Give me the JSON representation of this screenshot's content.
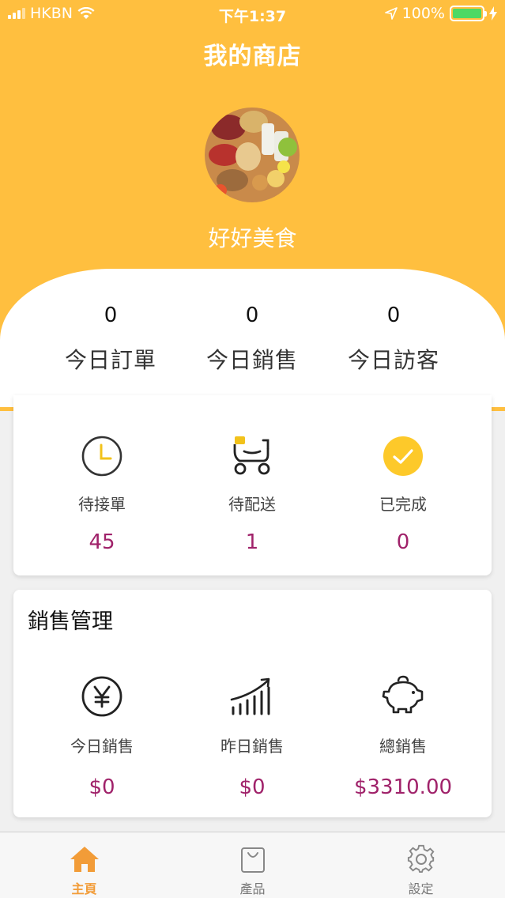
{
  "status_bar": {
    "carrier": "HKBN",
    "time": "下午1:37",
    "battery": "100%"
  },
  "header": {
    "title": "我的商店",
    "store_name": "好好美食"
  },
  "summary": [
    {
      "value": "0",
      "label": "今日訂單"
    },
    {
      "value": "0",
      "label": "今日銷售"
    },
    {
      "value": "0",
      "label": "今日訪客"
    }
  ],
  "orders": [
    {
      "icon": "clock-icon",
      "label": "待接單",
      "value": "45"
    },
    {
      "icon": "delivery-scooter-icon",
      "label": "待配送",
      "value": "1"
    },
    {
      "icon": "checkmark-circle-icon",
      "label": "已完成",
      "value": "0"
    }
  ],
  "sales": {
    "title": "銷售管理",
    "items": [
      {
        "icon": "yen-circle-icon",
        "label": "今日銷售",
        "value": "$0"
      },
      {
        "icon": "growth-chart-icon",
        "label": "昨日銷售",
        "value": "$0"
      },
      {
        "icon": "piggy-bank-icon",
        "label": "總銷售",
        "value": "$3310.00"
      }
    ]
  },
  "tabs": [
    {
      "icon": "home-icon",
      "label": "主頁",
      "active": true
    },
    {
      "icon": "shopping-bag-icon",
      "label": "產品",
      "active": false
    },
    {
      "icon": "gear-icon",
      "label": "設定",
      "active": false
    }
  ],
  "colors": {
    "header": "#ffbf3f",
    "value_text": "#a0226a",
    "active_tab": "#f29c38",
    "check_badge": "#fdc92a"
  }
}
